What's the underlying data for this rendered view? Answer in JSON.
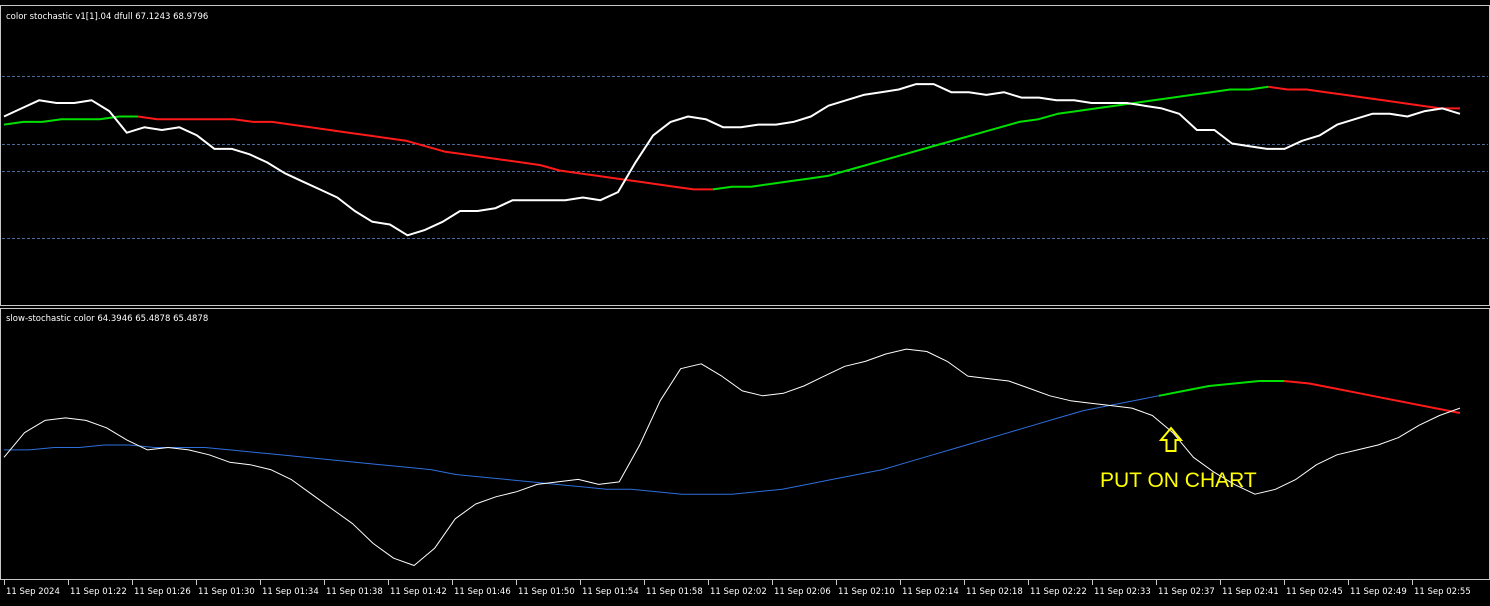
{
  "colors": {
    "background": "#000000",
    "frame": "#c8c8c8",
    "level_line": "#4a6a9a",
    "main_line": "#ffffff",
    "up": "#00e000",
    "down": "#ff1a1a",
    "signal_blue": "#2f6fdc",
    "annotation": "#ffff00"
  },
  "top_panel": {
    "label": "color stochastic v1[1].04 dfull 67.1243 68.9796"
  },
  "bottom_panel": {
    "label": "slow-stochastic color 64.3946 65.4878 65.4878"
  },
  "annotation": {
    "text": "PUT ON CHART",
    "icon": "up-arrow-icon"
  },
  "time_axis": {
    "labels": [
      "11 Sep 2024",
      "11 Sep 01:22",
      "11 Sep 01:26",
      "11 Sep 01:30",
      "11 Sep 01:34",
      "11 Sep 01:38",
      "11 Sep 01:42",
      "11 Sep 01:46",
      "11 Sep 01:50",
      "11 Sep 01:54",
      "11 Sep 01:58",
      "11 Sep 02:02",
      "11 Sep 02:06",
      "11 Sep 02:10",
      "11 Sep 02:14",
      "11 Sep 02:18",
      "11 Sep 02:22",
      "11 Sep 02:33",
      "11 Sep 02:37",
      "11 Sep 02:41",
      "11 Sep 02:45",
      "11 Sep 02:49",
      "11 Sep 02:55"
    ]
  },
  "chart_data": [
    {
      "type": "line",
      "title": "color stochastic v1[1].04 dfull 67.1243 68.9796",
      "ylim": [
        0,
        100
      ],
      "levels": [
        80,
        55,
        45,
        20
      ],
      "x": [
        0,
        2,
        4,
        6,
        8,
        10,
        12,
        14,
        16,
        18,
        20,
        22,
        24,
        26,
        28,
        30,
        32,
        34,
        36,
        38,
        40,
        42,
        44,
        46,
        48,
        50,
        52,
        54,
        56,
        58,
        60,
        62,
        64,
        66,
        68,
        70,
        72,
        74,
        76,
        78,
        80,
        82,
        84,
        86,
        88,
        90,
        92,
        94,
        96,
        98,
        100,
        102,
        104,
        106,
        108,
        110,
        112,
        114,
        116,
        118,
        120,
        122,
        124,
        126,
        128,
        130,
        132,
        134,
        136,
        138,
        140,
        142,
        144,
        146,
        148,
        150,
        152,
        154,
        156,
        158,
        160,
        162,
        164,
        166,
        168,
        170,
        172,
        174,
        176,
        178,
        180,
        182,
        184,
        186,
        188,
        190,
        192,
        194,
        196,
        198,
        200,
        202,
        204,
        206,
        208,
        210,
        212,
        214,
        216,
        218,
        220,
        222,
        224,
        226
      ],
      "series": [
        {
          "values": [
            65,
            68,
            71,
            70,
            70,
            71,
            67,
            59,
            61,
            60,
            61,
            58,
            53,
            53,
            51,
            48,
            44,
            41,
            38,
            35,
            30,
            26,
            25,
            21,
            23,
            26,
            30,
            30,
            31,
            34,
            34,
            34,
            34,
            35,
            34,
            37,
            48,
            58,
            63,
            65,
            64,
            61,
            61,
            62,
            62,
            63,
            65,
            69,
            71,
            73,
            74,
            75,
            77,
            77,
            74,
            74,
            73,
            74,
            72,
            72,
            71,
            71,
            70,
            70,
            70,
            69,
            68,
            66,
            60,
            60,
            55,
            54,
            53,
            53,
            56,
            58,
            62,
            64,
            66,
            66,
            65,
            67,
            68,
            66
          ],
          "x_values_step_note": "first 84 x points"
        },
        {
          "values": [
            62,
            63,
            63,
            64,
            64,
            64,
            65,
            65,
            64,
            64,
            64,
            64,
            64,
            63,
            63,
            62,
            61,
            60,
            59,
            58,
            57,
            56,
            54,
            52,
            51,
            50,
            49,
            48,
            47,
            45,
            44,
            43,
            42,
            41,
            40,
            39,
            38,
            38,
            39,
            39,
            40,
            41,
            42,
            43,
            45,
            47,
            49,
            51,
            53,
            55,
            57,
            59,
            61,
            63,
            64,
            66,
            67,
            68,
            69,
            70,
            71,
            72,
            73,
            74,
            75,
            75,
            76,
            75,
            75,
            74,
            73,
            72,
            71,
            70,
            69,
            68,
            68
          ]
        }
      ]
    },
    {
      "type": "line",
      "title": "slow-stochastic color 64.3946 65.4878 65.4878",
      "ylim": [
        0,
        100
      ],
      "series": [
        {
          "values": [
            45,
            55,
            60,
            61,
            60,
            57,
            52,
            48,
            49,
            48,
            46,
            43,
            42,
            40,
            36,
            30,
            24,
            18,
            10,
            4,
            1,
            8,
            20,
            26,
            29,
            31,
            34,
            35,
            36,
            34,
            35,
            50,
            68,
            81,
            83,
            78,
            72,
            70,
            71,
            74,
            78,
            82,
            84,
            87,
            89,
            88,
            84,
            78,
            77,
            76,
            73,
            70,
            68,
            67,
            66,
            65,
            62,
            55,
            45,
            39,
            34,
            30,
            32,
            36,
            42,
            46,
            48,
            50,
            53,
            58,
            62,
            65
          ]
        },
        {
          "values": [
            48,
            48,
            49,
            49,
            50,
            50,
            49,
            49,
            49,
            48,
            47,
            46,
            45,
            44,
            43,
            42,
            41,
            40,
            38,
            37,
            36,
            35,
            34,
            33,
            32,
            32,
            31,
            30,
            30,
            30,
            31,
            32,
            34,
            36,
            38,
            40,
            43,
            46,
            49,
            52,
            55,
            58,
            61,
            64,
            66,
            68,
            70,
            72,
            74,
            75,
            76,
            76,
            75,
            73,
            71,
            69,
            67,
            65,
            63
          ]
        }
      ]
    }
  ]
}
